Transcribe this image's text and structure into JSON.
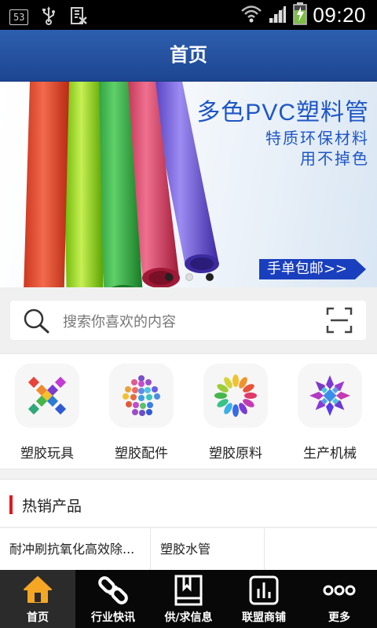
{
  "status_bar": {
    "notification_count": "53",
    "time": "09:20"
  },
  "header": {
    "title": "首页"
  },
  "banner": {
    "title": "多色PVC塑料管",
    "subtitle_1": "特质环保材料",
    "subtitle_2": "用不掉色",
    "badge": "手单包邮>>",
    "slides_total": 3,
    "active_slide": 1
  },
  "search": {
    "placeholder": "搜索你喜欢的内容"
  },
  "categories": [
    {
      "label": "塑胶玩具",
      "icon": "toy-icon"
    },
    {
      "label": "塑胶配件",
      "icon": "accessory-icon"
    },
    {
      "label": "塑胶原料",
      "icon": "raw-material-icon"
    },
    {
      "label": "生产机械",
      "icon": "machinery-icon"
    }
  ],
  "hot_products": {
    "heading": "热销产品",
    "items": [
      "耐冲刷抗氧化高效除...",
      "塑胶水管",
      ""
    ]
  },
  "tab_bar": {
    "items": [
      {
        "label": "首页",
        "icon": "home-icon",
        "active": true
      },
      {
        "label": "行业快讯",
        "icon": "link-icon",
        "active": false
      },
      {
        "label": "供/求信息",
        "icon": "book-icon",
        "active": false
      },
      {
        "label": "联盟商铺",
        "icon": "chart-icon",
        "active": false
      },
      {
        "label": "更多",
        "icon": "more-icon",
        "active": false
      }
    ]
  },
  "colors": {
    "header_blue": "#1d4591",
    "banner_blue": "#1e56c6",
    "accent_red": "#e4161b",
    "home_tab_icon": "#f5a623"
  }
}
